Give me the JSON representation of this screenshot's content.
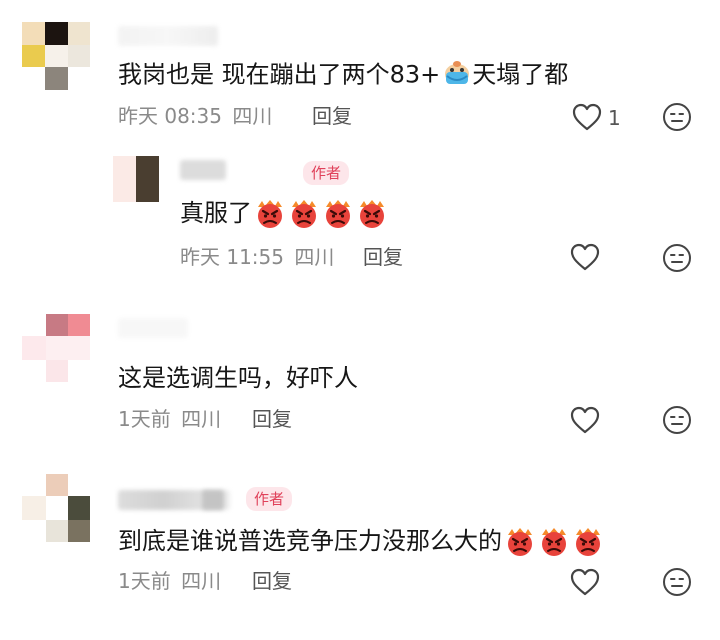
{
  "comments": [
    {
      "text_before": "我岗也是 现在蹦出了两个83+",
      "text_after": "天塌了都",
      "time": "昨天 08:35",
      "location": "四川",
      "reply_label": "回复",
      "like_count": "1"
    },
    {
      "author_badge": "作者",
      "text": "真服了",
      "time": "昨天 11:55",
      "location": "四川",
      "reply_label": "回复"
    },
    {
      "text": "这是选调生吗，好吓人",
      "time": "1天前",
      "location": "四川",
      "reply_label": "回复"
    },
    {
      "author_badge": "作者",
      "text": "到底是谁说普选竞争压力没那么大的",
      "time": "1天前",
      "location": "四川",
      "reply_label": "回复"
    }
  ],
  "icons": {
    "like": "heart-outline-icon",
    "react": "neutral-face-icon",
    "angry": "angry-face-emoji",
    "crying": "crying-face-emoji"
  },
  "colors": {
    "author_badge_text": "#e0415a",
    "author_badge_bg": "#fde6ea",
    "meta_text": "#8a8a8a"
  }
}
